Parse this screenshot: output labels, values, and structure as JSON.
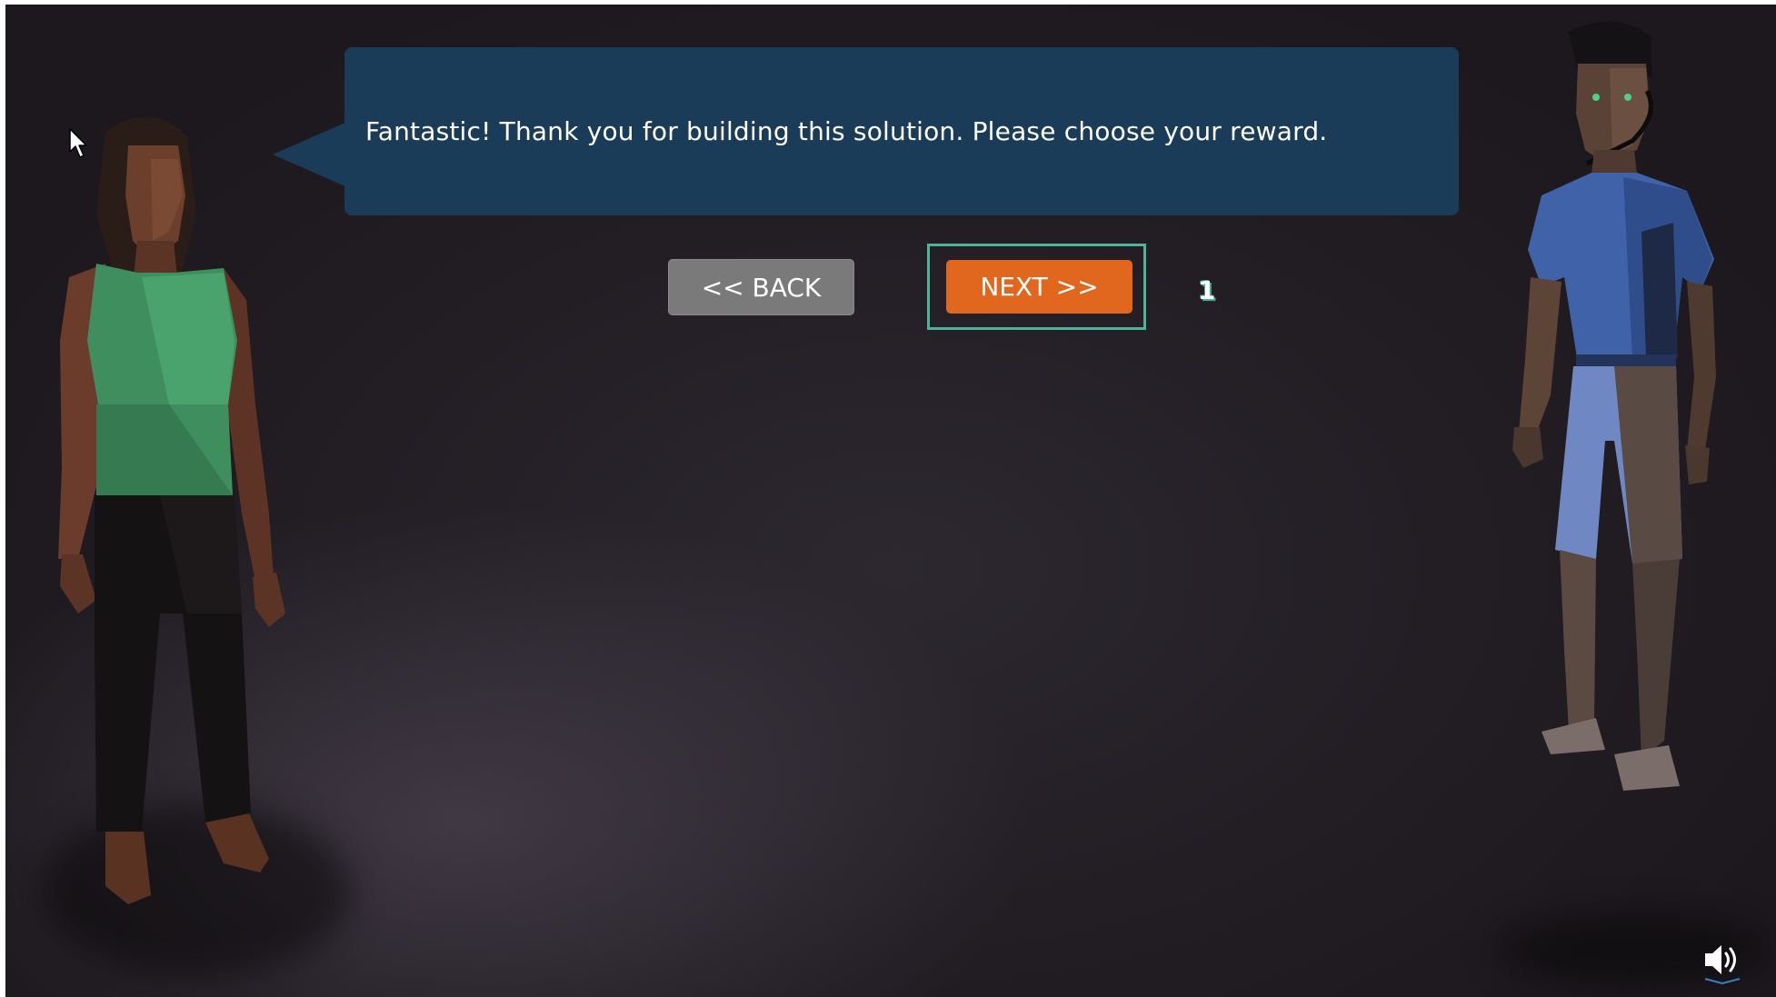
{
  "dialog": {
    "message": "Fantastic! Thank you for building this solution. Please choose your reward."
  },
  "navigation": {
    "back_label": "<< BACK",
    "next_label": "NEXT >>"
  },
  "step_marker": {
    "value": "1"
  },
  "icons": {
    "cursor": "mouse-pointer-icon",
    "sound": "speaker-volume-icon"
  },
  "colors": {
    "bubble": "#1b3c59",
    "next_button": "#e1661e",
    "back_button": "#7a7a7a",
    "focus_ring": "#4fb39a",
    "background": "#221e24"
  }
}
